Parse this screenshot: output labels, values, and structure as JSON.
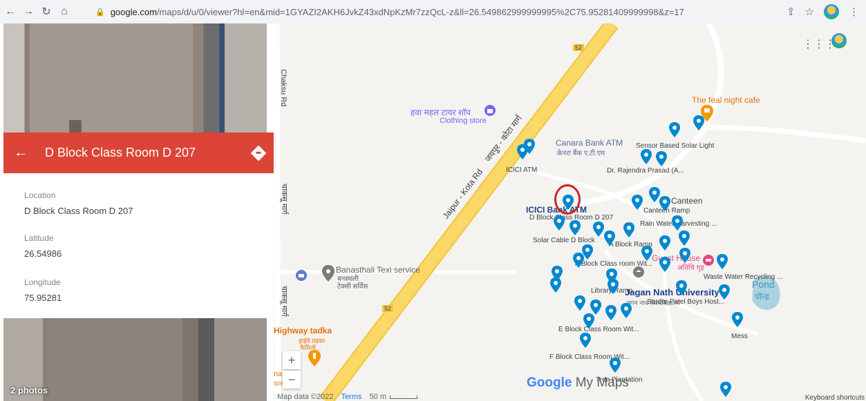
{
  "browser": {
    "url_domain": "google.com",
    "url_rest": "/maps/d/u/0/viewer?hl=en&mid=1GYAZI2AKH6JvkZ43xdNpKzMr7zzQcL-z&ll=26.549862999999995%2C75.95281409999998&z=17"
  },
  "panel": {
    "title": "D Block Class Room D 207",
    "fields": [
      {
        "label": "Location",
        "value": "D Block Class Room D 207"
      },
      {
        "label": "Latitude",
        "value": "26.54986"
      },
      {
        "label": "Longitude",
        "value": "75.95281"
      }
    ],
    "photo_count": "2 photos"
  },
  "map": {
    "road_labels": {
      "chaksu": "Chaksu Rd",
      "chaksu_hi": "चाकसू मार्ग",
      "chaksu_hi2": "चाकसू मार्ग",
      "jaipur_kota": "Jaipur - Kota Rd",
      "jaipur_kota_hi": "जयपुर - कोटा मार्ग",
      "shield_top": "52",
      "shield_bottom": "52"
    },
    "places": {
      "hawa_mahal": "हवा महल टायर शॉप",
      "clothing_store": "Clothing store",
      "canara": "Canara Bank ATM",
      "canara_hi": "केनरा बैंक ए.टी.एम",
      "icici_atm": "ICICI ATM",
      "icici_bank": "ICICI Bank ATM",
      "feal_cafe": "The feal night cafe",
      "sensor_solar": "Sensor Based Solar Light",
      "rajendra": "Dr. Rajendra Prasad (A...",
      "canteen": "Canteen",
      "canteen_ramp": "Canteen Ramp",
      "d_block": "D Block Class Room D 207",
      "rain_water": "Rain Water Harvesting ...",
      "solar_cable": "Solar Cable D Block",
      "a_block_ramp": "A Block Ramp",
      "guest_house": "Guest House",
      "guest_house_hi": "अतिथि गृह",
      "a_block_class": "A Block Class room Wit...",
      "banasthali_taxi": "Banasthali Texi service",
      "banasthali_hi1": "बनस्थली",
      "banasthali_hi2": "टेक्सी सर्विस",
      "waste_water": "Waste Water Recycling ...",
      "pond": "Pond",
      "pond_hi": "पॉन्ड",
      "library_ramp": "Library Ramp",
      "university": "Jagan Nath University",
      "university_hi": "जगन नाथ विश्वविद्यालय",
      "sardar_patel": "Sardar Patel Boys Host...",
      "highway_tadka": "Highway tadka",
      "highway_hi1": "हाईवे तड़का",
      "highway_hi2": "फैमिली...",
      "e_block": "E Block Class Room Wit...",
      "mess": "Mess",
      "f_block": "F Block Class Room Wit...",
      "tree": "Tree Plantation",
      "na": "na",
      "na_hi": "पान"
    },
    "attribution": "Map data ©2022",
    "terms": "Terms",
    "scale": "50 m",
    "keyboard": "Keyboard shortcuts",
    "brand_google": "Google",
    "brand_mymaps": "My Maps",
    "zoom_in": "+",
    "zoom_out": "−"
  },
  "colors": {
    "header": "#db4437",
    "pin": "#0288d1",
    "road": "#fbd866",
    "pink": "#e8447c",
    "orange": "#f29900"
  }
}
